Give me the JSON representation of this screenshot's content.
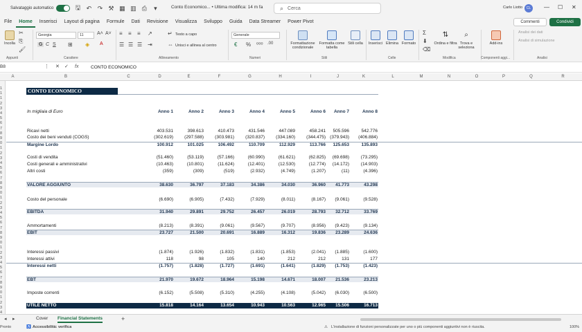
{
  "titlebar": {
    "autosave_label": "Salvataggio automatico",
    "doc_title": "Conto Economico... • Ultima modifica: 14 m fa",
    "search_placeholder": "Cerca",
    "user_name": "Carlo Liotto",
    "user_initials": "CL"
  },
  "ribbon_tabs": [
    "File",
    "Home",
    "Inserisci",
    "Layout di pagina",
    "Formule",
    "Dati",
    "Revisione",
    "Visualizza",
    "Sviluppo",
    "Guida",
    "Data Streamer",
    "Power Pivot"
  ],
  "ribbon_tabs_active": "Home",
  "ribbon_buttons": {
    "comments": "Commenti",
    "share": "Condividi"
  },
  "ribbon": {
    "paste": "Incolla",
    "font_name": "Georgia",
    "font_size": "11",
    "wrap_text": "Testo a capo",
    "merge_center": "Unisci e allinea al centro",
    "number_format": "Generale",
    "conditional_format": "Formattazione condizionale",
    "format_table": "Formatta come tabella",
    "cell_styles": "Stili cella",
    "insert": "Inserisci",
    "delete": "Elimina",
    "format": "Formato",
    "sort_filter": "Ordina e filtra",
    "find_select": "Trova e seleziona",
    "addin": "Add-ins",
    "analyze_data": "Analisi dei dati",
    "sim_analysis": "Analisi di simulazione",
    "groups": [
      "Appunti",
      "Carattere",
      "Allineamento",
      "Numeri",
      "Stili",
      "Celle",
      "Modifica",
      "Componenti aggi...",
      "Analisi"
    ]
  },
  "formula_bar": {
    "cell_ref": "B8",
    "content": "CONTO ECONOMICO"
  },
  "columns": [
    "A",
    "B",
    "C",
    "D",
    "E",
    "F",
    "G",
    "H",
    "I",
    "J",
    "K",
    "L",
    "M",
    "N",
    "O",
    "P",
    "Q",
    "R"
  ],
  "row_numbers": [
    "1",
    "1",
    "1",
    "2",
    "3",
    "4",
    "5",
    "6",
    "7",
    "8",
    "9",
    "0",
    "1",
    "2",
    "3",
    "4",
    "5",
    "6",
    "7",
    "8",
    "9",
    "0",
    "1",
    "2",
    "3",
    "4",
    "5",
    "6",
    "7",
    "8",
    "9",
    "0",
    "1",
    "2",
    "3",
    "4",
    "5",
    "6",
    "7",
    "8",
    "9",
    "0",
    "1",
    "2",
    "3",
    "4",
    "5"
  ],
  "sheet": {
    "title": "CONTO ECONOMICO",
    "subtitle": "In migliaia di Euro",
    "years": [
      "Anno 1",
      "Anno 2",
      "Anno 3",
      "Anno 4",
      "Anno 5",
      "Anno 6",
      "Anno 7",
      "Anno 8"
    ],
    "rows": [
      {
        "label": "Ricavi netti",
        "values": [
          "403.531",
          "398.613",
          "410.473",
          "431.546",
          "447.089",
          "458.241",
          "505.596",
          "542.776"
        ]
      },
      {
        "label": "Costo dei beni venduti (COGS)",
        "values": [
          "(302.619)",
          "(297.588)",
          "(303.981)",
          "(320.837)",
          "(334.160)",
          "(344.475)",
          "(379.943)",
          "(406.884)"
        ]
      },
      {
        "label": "Margine Lordo",
        "values": [
          "100.912",
          "101.025",
          "106.492",
          "110.709",
          "112.929",
          "113.766",
          "125.653",
          "135.893"
        ]
      },
      {
        "label": "Costi di vendita",
        "values": [
          "(51.460)",
          "(53.119)",
          "(57.166)",
          "(60.990)",
          "(61.621)",
          "(62.825)",
          "(69.698)",
          "(73.295)"
        ]
      },
      {
        "label": "Costi generali e amministrativi",
        "values": [
          "(10.463)",
          "(10.801)",
          "(11.624)",
          "(12.401)",
          "(12.530)",
          "(12.774)",
          "(14.172)",
          "(14.903)"
        ]
      },
      {
        "label": "Altri costi",
        "values": [
          "(359)",
          "(309)",
          "(519)",
          "(2.932)",
          "(4.749)",
          "(1.207)",
          "(11)",
          "(4.396)"
        ]
      },
      {
        "label": "VALORE AGGIUNTO",
        "values": [
          "38.630",
          "36.797",
          "37.183",
          "34.386",
          "34.030",
          "36.960",
          "41.773",
          "43.298"
        ]
      },
      {
        "label": "Costo del personale",
        "values": [
          "(6.690)",
          "(6.905)",
          "(7.432)",
          "(7.929)",
          "(8.011)",
          "(8.167)",
          "(9.061)",
          "(9.528)"
        ]
      },
      {
        "label": "EBITDA",
        "values": [
          "31.940",
          "29.891",
          "29.752",
          "26.457",
          "26.019",
          "28.793",
          "32.712",
          "33.769"
        ]
      },
      {
        "label": "Ammortamenti",
        "values": [
          "(8.213)",
          "(8.391)",
          "(9.061)",
          "(9.567)",
          "(9.707)",
          "(8.956)",
          "(9.423)",
          "(9.134)"
        ]
      },
      {
        "label": "EBIT",
        "values": [
          "23.727",
          "21.500",
          "20.691",
          "16.889",
          "16.312",
          "19.836",
          "23.289",
          "24.636"
        ]
      },
      {
        "label": "Interessi passivi",
        "values": [
          "(1.874)",
          "(1.926)",
          "(1.832)",
          "(1.831)",
          "(1.853)",
          "(2.041)",
          "(1.885)",
          "(1.600)"
        ]
      },
      {
        "label": "Interessi attivi",
        "values": [
          "118",
          "98",
          "105",
          "140",
          "212",
          "212",
          "131",
          "177"
        ]
      },
      {
        "label": "Interessi netti",
        "values": [
          "(1.757)",
          "(1.828)",
          "(1.727)",
          "(1.691)",
          "(1.641)",
          "(1.829)",
          "(1.753)",
          "(1.423)"
        ]
      },
      {
        "label": "EBT",
        "values": [
          "21.970",
          "19.672",
          "18.964",
          "15.198",
          "14.671",
          "18.007",
          "21.536",
          "23.213"
        ]
      },
      {
        "label": "Imposte correnti",
        "values": [
          "(6.152)",
          "(5.508)",
          "(5.310)",
          "(4.255)",
          "(4.108)",
          "(5.042)",
          "(6.030)",
          "(6.500)"
        ]
      },
      {
        "label": "UTILE NETTO",
        "values": [
          "15.818",
          "14.164",
          "13.654",
          "10.943",
          "10.563",
          "12.965",
          "15.506",
          "16.713"
        ]
      }
    ]
  },
  "sheet_tabs": [
    "Cover",
    "Financial Statements"
  ],
  "sheet_tabs_active": "Financial Statements",
  "status": {
    "left": "Pronto",
    "accessibility": "Accessibilità: verifica",
    "message": "L'installazione di funzioni personalizzate per uno o più componenti aggiuntivi non è riuscita.",
    "zoom": "100%"
  }
}
